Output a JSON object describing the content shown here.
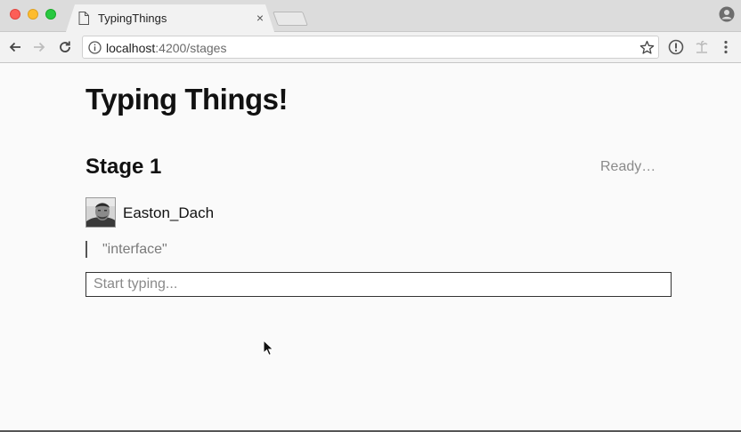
{
  "browser": {
    "tab": {
      "title": "TypingThings",
      "close_glyph": "×"
    },
    "address": {
      "host": "localhost",
      "rest": ":4200/stages"
    },
    "icons": {
      "back": "arrow-left-icon",
      "forward": "arrow-right-icon",
      "reload": "reload-icon",
      "info": "info-icon",
      "star": "star-icon",
      "profile": "profile-icon",
      "menu": "kebab-menu-icon"
    }
  },
  "app": {
    "title": "Typing Things!",
    "stage": {
      "title": "Stage 1",
      "status": "Ready…"
    },
    "player": {
      "name": "Easton_Dach"
    },
    "word": "\"interface\"",
    "input": {
      "placeholder": "Start typing...",
      "value": ""
    }
  },
  "colors": {
    "page_bg": "#fafafa",
    "tab_bg": "#f2f2f2",
    "tabstrip_bg": "#dcdcdc",
    "status_text": "#8a8a8a"
  }
}
